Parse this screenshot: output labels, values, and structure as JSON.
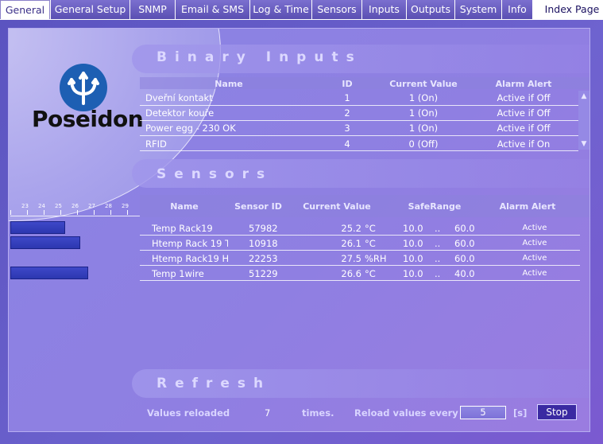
{
  "tabs": [
    {
      "label": "General"
    },
    {
      "label": "General Setup"
    },
    {
      "label": "SNMP"
    },
    {
      "label": "Email & SMS"
    },
    {
      "label": "Log & Time"
    },
    {
      "label": "Sensors"
    },
    {
      "label": "Inputs"
    },
    {
      "label": "Outputs"
    },
    {
      "label": "System"
    },
    {
      "label": "Info"
    },
    {
      "label": "Index Page"
    }
  ],
  "brand": {
    "logo_text": "Poseidon",
    "logo_color": "#1d5fb3"
  },
  "binary_inputs": {
    "title": "Binary Inputs",
    "columns": [
      "Name",
      "ID",
      "Current Value",
      "Alarm Alert"
    ],
    "rows": [
      {
        "name": "Dveřní kontakt",
        "id": "1",
        "value": "1 (On)",
        "alert": "Active if Off"
      },
      {
        "name": "Detektor kouře",
        "id": "2",
        "value": "1 (On)",
        "alert": "Active if Off"
      },
      {
        "name": "Power egg - 230 OK",
        "id": "3",
        "value": "1 (On)",
        "alert": "Active if Off"
      },
      {
        "name": "RFID",
        "id": "4",
        "value": "0 (Off)",
        "alert": "Active if On"
      }
    ]
  },
  "sensors": {
    "title": "Sensors",
    "scale_labels": [
      "23",
      "24",
      "25",
      "26",
      "27",
      "28",
      "29"
    ],
    "columns": [
      "Name",
      "Sensor ID",
      "Current Value",
      "SafeRange",
      "Alarm Alert"
    ],
    "rows": [
      {
        "name": "Temp Rack19",
        "id": "57982",
        "value": "25.2",
        "unit": "°C",
        "min": "10.0",
        "sep": "..",
        "max": "60.0",
        "alert": "Active",
        "bar_fraction": 0.43
      },
      {
        "name": "Htemp Rack 19 T",
        "id": "10918",
        "value": "26.1",
        "unit": "°C",
        "min": "10.0",
        "sep": "..",
        "max": "60.0",
        "alert": "Active",
        "bar_fraction": 0.55
      },
      {
        "name": "Htemp Rack19 H",
        "id": "22253",
        "value": "27.5",
        "unit": "%RH",
        "min": "10.0",
        "sep": "..",
        "max": "60.0",
        "alert": "Active",
        "bar_fraction": 0
      },
      {
        "name": "Temp 1wire",
        "id": "51229",
        "value": "26.6",
        "unit": "°C",
        "min": "10.0",
        "sep": "..",
        "max": "40.0",
        "alert": "Active",
        "bar_fraction": 0.61
      }
    ]
  },
  "refresh": {
    "title": "Refresh",
    "reloaded_label": "Values reloaded",
    "reloaded_count": "7",
    "times_label": "times.",
    "reload_every_label": "Reload values every",
    "interval_value": "5",
    "unit_label": "[s]",
    "stop_label": "Stop"
  }
}
